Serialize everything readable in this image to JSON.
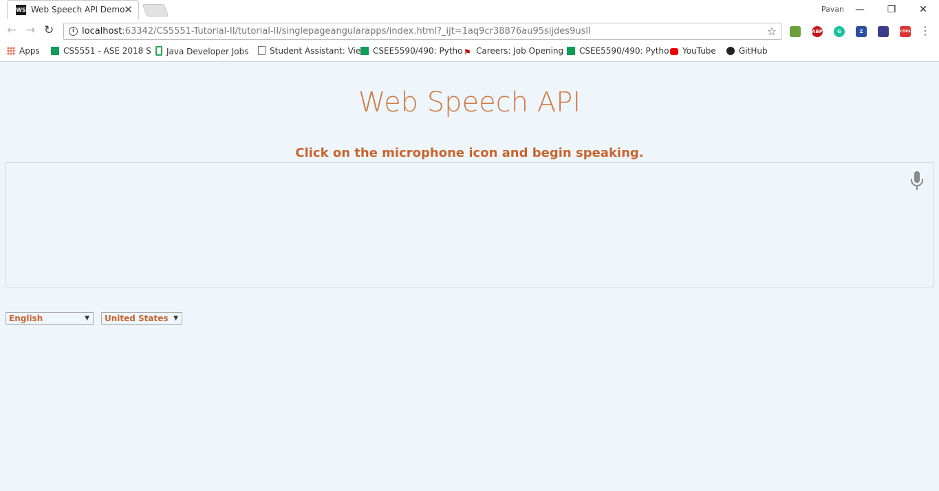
{
  "browser": {
    "tab_title": "Web Speech API Demo",
    "tab_favicon": "WS",
    "tab_close": "✕",
    "profile_name": "Pavan",
    "url_host": "localhost",
    "url_rest": ":63342/CS5551-Tutorial-II/tutorial-II/singlepageangularapps/index.html?_ijt=1aq9cr38876au95sijdes9usll",
    "window_controls": {
      "minimize": "—",
      "restore": "❐",
      "close": "✕"
    },
    "extensions": [
      {
        "icon": "chart-extension-icon",
        "text": "",
        "color": "#6a9f3a"
      },
      {
        "icon": "adblock-plus-icon",
        "text": "ABP",
        "color": "#c4161c"
      },
      {
        "icon": "grammarly-icon",
        "text": "G",
        "color": "#15c39a"
      },
      {
        "icon": "zotero-icon",
        "text": "Z",
        "color": "#2d4fa0"
      },
      {
        "icon": "bookmark-extension-icon",
        "text": "",
        "color": "#3c3c8a"
      },
      {
        "icon": "cors-icon",
        "text": "CORS",
        "color": "#d33"
      }
    ]
  },
  "bookmarks": [
    {
      "label": "Apps",
      "icon": "apps-grid-icon"
    },
    {
      "label": "CS5551 - ASE 2018 S",
      "icon": "sheet-icon"
    },
    {
      "label": "Java Developer Jobs",
      "icon": "phone-icon"
    },
    {
      "label": "Student Assistant: Vie",
      "icon": "document-icon"
    },
    {
      "label": "CSEE5590/490: Pytho",
      "icon": "sheet-icon"
    },
    {
      "label": "Careers: Job Opening",
      "icon": "flag-icon"
    },
    {
      "label": "CSEE5590/490: Pytho",
      "icon": "sheet-icon"
    },
    {
      "label": "YouTube",
      "icon": "youtube-icon"
    },
    {
      "label": "GitHub",
      "icon": "github-icon"
    }
  ],
  "page": {
    "title": "Web Speech API",
    "info": "Click on the microphone icon and begin speaking.",
    "language_select": "English",
    "dialect_select": "United States"
  },
  "colors": {
    "accent": "#c8642e",
    "background": "#eef6fc"
  }
}
